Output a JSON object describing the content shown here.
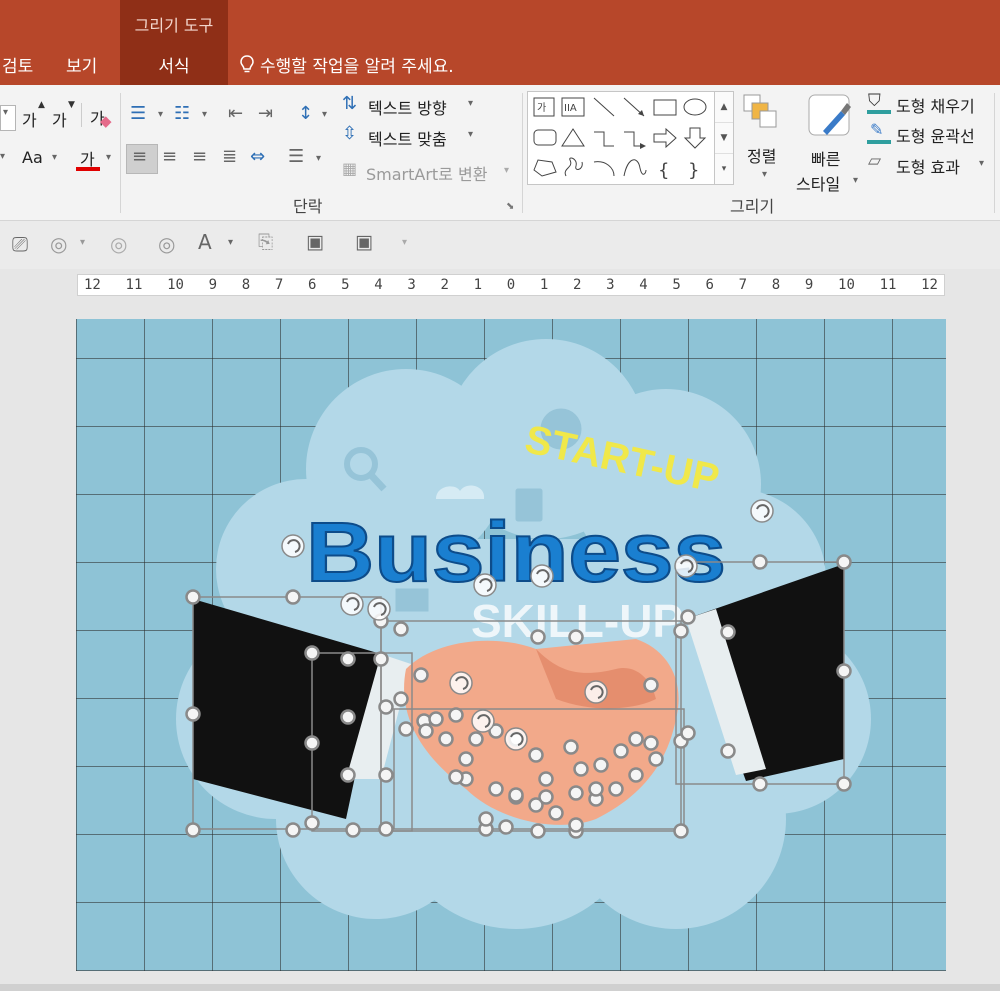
{
  "title_bar": {
    "context_group": "그리기 도구",
    "tabs": [
      "검토",
      "보기",
      "서식"
    ],
    "tell_me": "수행할 작업을 알려 주세요."
  },
  "ribbon": {
    "font_group": {
      "grow_font": "가",
      "shrink_font": "가",
      "clear_format": "가",
      "change_case": "Aa",
      "font_color": "가"
    },
    "paragraph_group": {
      "label": "단락",
      "text_direction": "텍스트 방향",
      "align_text": "텍스트 맞춤",
      "smartart": "SmartArt로 변환"
    },
    "drawing_group": {
      "label": "그리기",
      "arrange": "정렬",
      "quick_styles_1": "빠른",
      "quick_styles_2": "스타일",
      "shape_fill": "도형 채우기",
      "shape_outline": "도형 윤곽선",
      "shape_effects": "도형 효과",
      "gallery_text_1": "가",
      "gallery_text_2": "IIA",
      "gallery_brace_1": "{",
      "gallery_brace_2": "}"
    }
  },
  "ruler": {
    "ticks": [
      "12",
      "11",
      "10",
      "9",
      "8",
      "7",
      "6",
      "5",
      "4",
      "3",
      "2",
      "1",
      "0",
      "1",
      "2",
      "3",
      "4",
      "5",
      "6",
      "7",
      "8",
      "9",
      "10",
      "11",
      "12"
    ]
  },
  "slide": {
    "start_up_text": "START-UP",
    "business_text": "Business",
    "skill_up_text": "SKILL-UP",
    "colors": {
      "background": "#8ec3d6",
      "cloud": "#b3d8e8",
      "business": "#1a7fd0",
      "start_up": "#f0e84a",
      "sleeve": "#111111",
      "hand": "#f2a98a"
    }
  }
}
